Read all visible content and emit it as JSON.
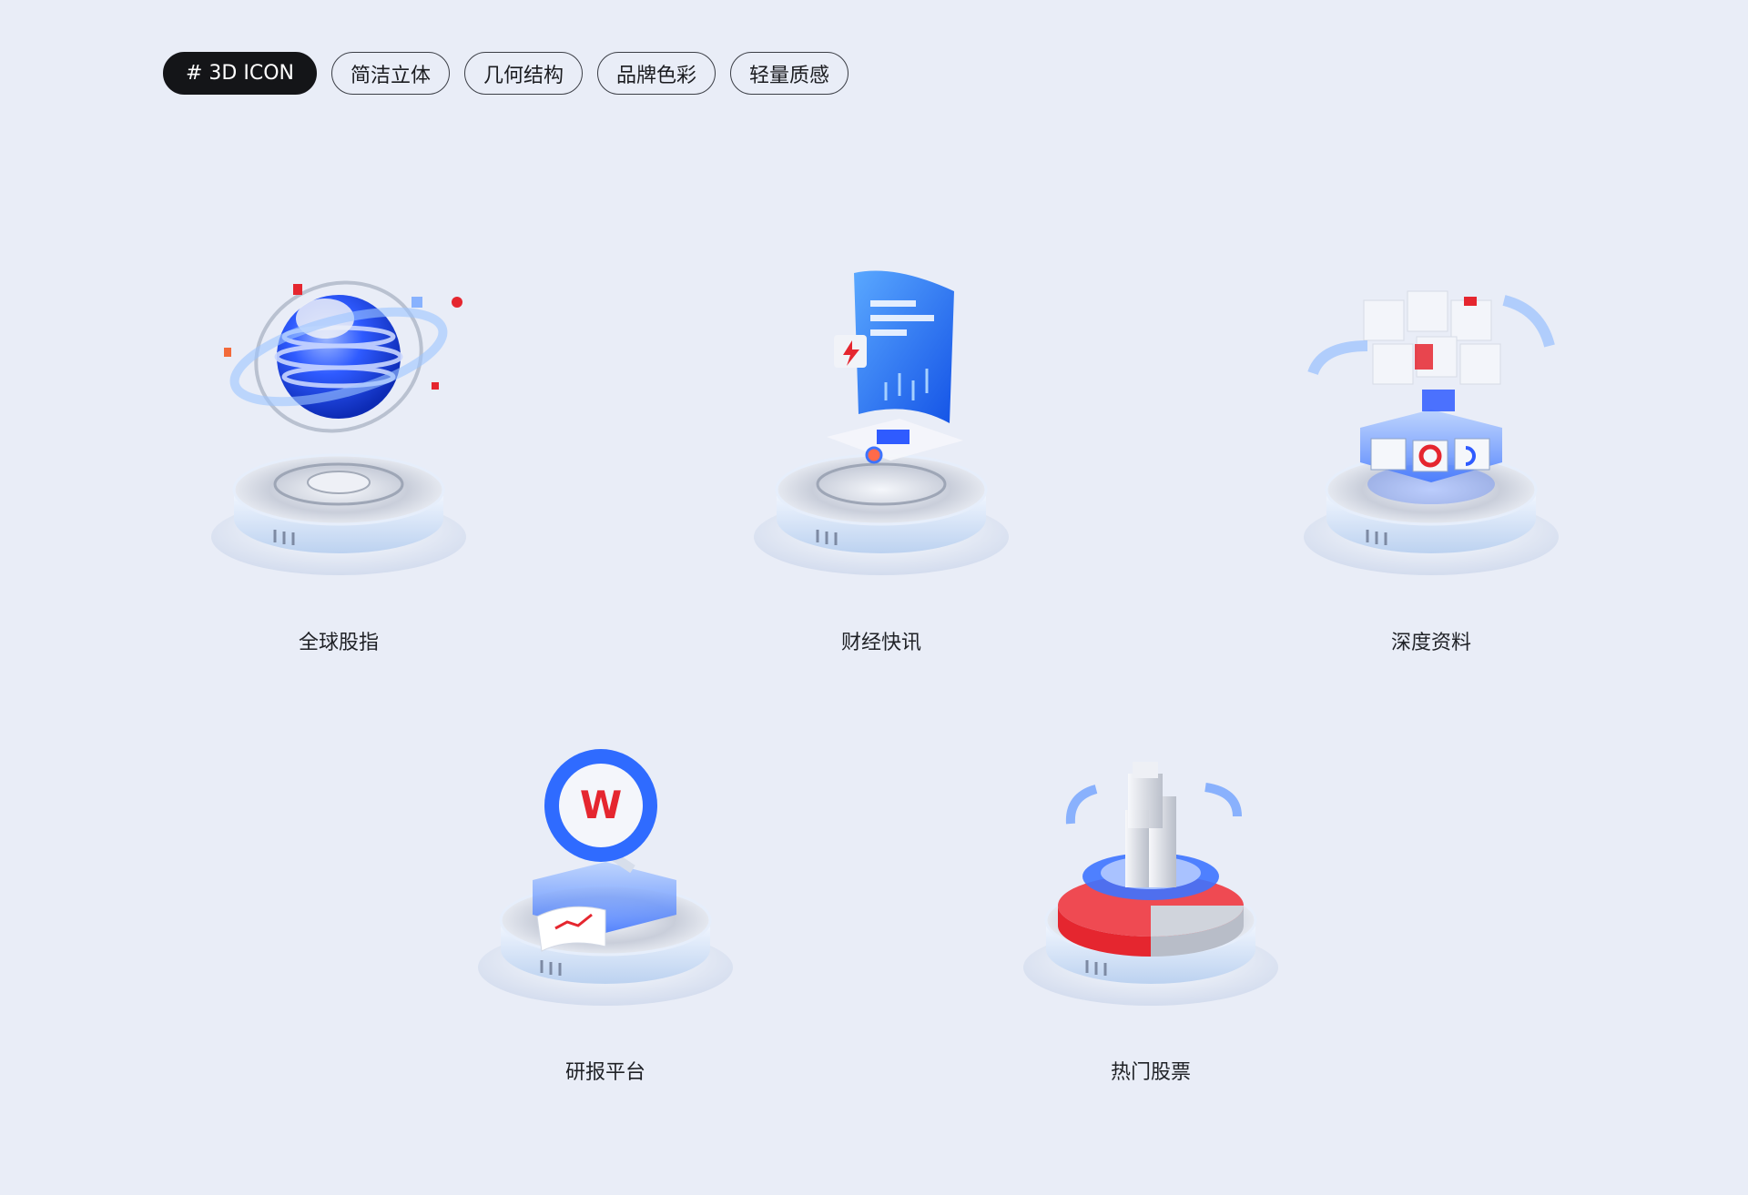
{
  "tags": {
    "primary": "# 3D ICON",
    "items": [
      "简洁立体",
      "几何结构",
      "品牌色彩",
      "轻量质感"
    ]
  },
  "icons": [
    {
      "label": "全球股指",
      "icon": "globe-orbit-icon"
    },
    {
      "label": "财经快讯",
      "icon": "news-sheet-icon"
    },
    {
      "label": "深度资料",
      "icon": "data-cube-icon"
    },
    {
      "label": "研报平台",
      "icon": "research-search-icon"
    },
    {
      "label": "热门股票",
      "icon": "hot-stocks-bars-icon"
    }
  ],
  "colors": {
    "background": "#e9edf7",
    "brand_blue": "#2f5bff",
    "accent_red": "#e5262f",
    "platform": "#dce6f5"
  }
}
